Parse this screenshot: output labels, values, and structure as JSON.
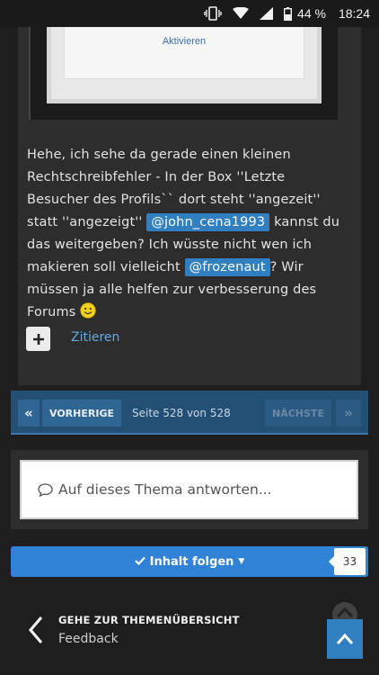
{
  "status_bar": {
    "battery": "44 %",
    "time": "18:24"
  },
  "embed": {
    "activate_label": "Aktivieren"
  },
  "post": {
    "text_1": "Hehe, ich sehe da gerade einen kleinen Rechtschreibfehler - In der Box ''Letzte Besucher des Profils`` dort steht ''angezeit'' statt ''angezeigt'' ",
    "mention_1": "@john_cena1993",
    "text_2": " kannst du das weitergeben? Ich wüsste nicht wen ich makieren soll vielleicht ",
    "mention_2": "@frozenaut",
    "text_3": "? Wir müssen ja alle helfen zur verbesserung des Forums ",
    "smiley_icon": "smiley-icon",
    "quote_label": "Zitieren"
  },
  "pagination": {
    "first_icon": "«",
    "prev_label": "VORHERIGE",
    "page_text": "Seite 528 von 528",
    "next_label": "NÄCHSTE",
    "last_icon": "»"
  },
  "reply": {
    "placeholder": "Auf dieses Thema antworten..."
  },
  "follow": {
    "label": "Inhalt folgen",
    "count": "33"
  },
  "navigation": {
    "title": "GEHE ZUR THEMENÜBERSICHT",
    "subtitle": "Feedback"
  },
  "colors": {
    "accent": "#2f82d6",
    "pager_bg": "#244f74",
    "mention_bg": "#2f7fc1",
    "background": "#1e1e1e"
  }
}
